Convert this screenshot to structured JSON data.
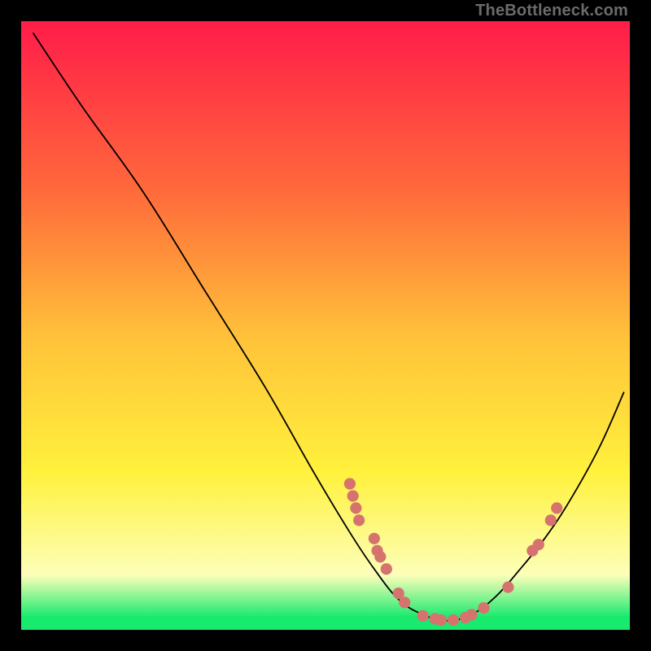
{
  "attribution": "TheBottleneck.com",
  "colors": {
    "frame": "#000000",
    "curve": "#000000",
    "points": "#d6736f",
    "grad_top": "#ff1c49",
    "grad_mid_upper": "#ff6a3b",
    "grad_mid": "#ffc23a",
    "grad_mid_lower": "#fff13c",
    "grad_light": "#fdffb9",
    "grad_bottom": "#17ea6d"
  },
  "chart_data": {
    "type": "line",
    "title": "",
    "xlabel": "",
    "ylabel": "",
    "xlim": [
      0,
      100
    ],
    "ylim": [
      0,
      100
    ],
    "curve": [
      {
        "x": 2,
        "y": 98
      },
      {
        "x": 10,
        "y": 86
      },
      {
        "x": 20,
        "y": 72
      },
      {
        "x": 30,
        "y": 56
      },
      {
        "x": 40,
        "y": 40
      },
      {
        "x": 48,
        "y": 26
      },
      {
        "x": 54,
        "y": 16
      },
      {
        "x": 58,
        "y": 10
      },
      {
        "x": 62,
        "y": 5
      },
      {
        "x": 66,
        "y": 2.5
      },
      {
        "x": 70,
        "y": 1.5
      },
      {
        "x": 74,
        "y": 2.5
      },
      {
        "x": 78,
        "y": 5.5
      },
      {
        "x": 82,
        "y": 10
      },
      {
        "x": 86,
        "y": 15
      },
      {
        "x": 90,
        "y": 21
      },
      {
        "x": 95,
        "y": 30
      },
      {
        "x": 99,
        "y": 39
      }
    ],
    "points": [
      {
        "x": 54,
        "y": 24
      },
      {
        "x": 54.5,
        "y": 22
      },
      {
        "x": 55,
        "y": 20
      },
      {
        "x": 55.5,
        "y": 18
      },
      {
        "x": 58,
        "y": 15
      },
      {
        "x": 58.5,
        "y": 13
      },
      {
        "x": 59,
        "y": 12
      },
      {
        "x": 60,
        "y": 10
      },
      {
        "x": 62,
        "y": 6
      },
      {
        "x": 63,
        "y": 4.5
      },
      {
        "x": 66,
        "y": 2.3
      },
      {
        "x": 68,
        "y": 1.8
      },
      {
        "x": 69,
        "y": 1.6
      },
      {
        "x": 71,
        "y": 1.6
      },
      {
        "x": 73,
        "y": 2.0
      },
      {
        "x": 74,
        "y": 2.5
      },
      {
        "x": 76,
        "y": 3.6
      },
      {
        "x": 80,
        "y": 7
      },
      {
        "x": 84,
        "y": 13
      },
      {
        "x": 85,
        "y": 14
      },
      {
        "x": 87,
        "y": 18
      },
      {
        "x": 88,
        "y": 20
      }
    ]
  }
}
